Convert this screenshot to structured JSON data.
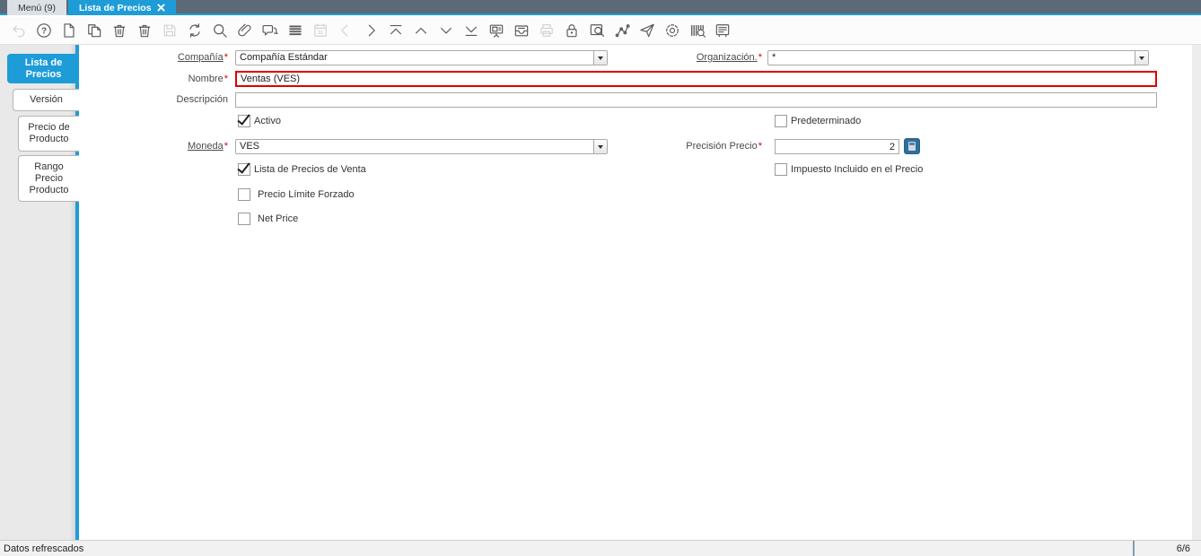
{
  "window_tabs": [
    {
      "label": "Menú (9)",
      "active": false
    },
    {
      "label": "Lista de Precios",
      "active": true
    }
  ],
  "toolbar": {
    "help_glyph": "?",
    "calendar_glyph": "31",
    "icons": [
      {
        "name": "undo",
        "disabled": true
      },
      {
        "name": "help",
        "disabled": false
      },
      {
        "name": "new-record",
        "disabled": false
      },
      {
        "name": "copy-record",
        "disabled": false
      },
      {
        "name": "delete-record",
        "disabled": false
      },
      {
        "name": "delete-selection",
        "disabled": false
      },
      {
        "name": "save",
        "disabled": true
      },
      {
        "name": "refresh",
        "disabled": false
      },
      {
        "name": "find",
        "disabled": false
      },
      {
        "name": "attachment",
        "disabled": false
      },
      {
        "name": "chat",
        "disabled": false
      },
      {
        "name": "grid-toggle",
        "disabled": false
      },
      {
        "name": "calendar",
        "disabled": true
      },
      {
        "name": "previous-record",
        "disabled": true
      },
      {
        "name": "next-record",
        "disabled": false
      },
      {
        "name": "first-record",
        "disabled": false
      },
      {
        "name": "parent-record",
        "disabled": false
      },
      {
        "name": "detail-record",
        "disabled": false
      },
      {
        "name": "last-record",
        "disabled": false
      },
      {
        "name": "report",
        "disabled": false
      },
      {
        "name": "archive",
        "disabled": false
      },
      {
        "name": "print",
        "disabled": true
      },
      {
        "name": "lock",
        "disabled": false
      },
      {
        "name": "zoom-across",
        "disabled": false
      },
      {
        "name": "workflow",
        "disabled": false
      },
      {
        "name": "send",
        "disabled": false
      },
      {
        "name": "settings",
        "disabled": false
      },
      {
        "name": "product-info",
        "disabled": false
      },
      {
        "name": "window",
        "disabled": false
      }
    ]
  },
  "sidebar": {
    "tabs": [
      {
        "label": "Lista de Precios",
        "active": true
      },
      {
        "label": "Versión",
        "active": false
      },
      {
        "label": "Precio de Producto",
        "active": false
      },
      {
        "label": "Rango Precio Producto",
        "active": false
      }
    ]
  },
  "form": {
    "required_marker": "*",
    "fields": {
      "compania": {
        "label": "Compañía",
        "value": "Compañía Estándar",
        "required": true
      },
      "organizacion": {
        "label": "Organización.",
        "value": "*",
        "required": true
      },
      "nombre": {
        "label": "Nombre",
        "value": "Ventas (VES)",
        "required": true
      },
      "descripcion": {
        "label": "Descripción",
        "value": ""
      },
      "activo": {
        "label": "Activo",
        "checked": true
      },
      "predeterminado": {
        "label": "Predeterminado",
        "checked": false
      },
      "moneda": {
        "label": "Moneda",
        "value": "VES",
        "required": true
      },
      "precision_precio": {
        "label": "Precisión Precio",
        "value": "2",
        "required": true
      },
      "lista_de_precios_de_venta": {
        "label": "Lista de Precios de Venta",
        "checked": true
      },
      "impuesto_incluido": {
        "label": "Impuesto Incluido en el Precio",
        "checked": false
      },
      "precio_limite_forzado": {
        "label": "Precio Límite Forzado",
        "checked": false
      },
      "net_price": {
        "label": "Net Price",
        "checked": false
      }
    }
  },
  "statusbar": {
    "message": "Datos refrescados",
    "record_indicator": "6/6"
  },
  "colors": {
    "accent_blue": "#1e9cd8",
    "topbar_slate": "#5b6a76",
    "highlight_red": "#e00000",
    "calculator_button_blue": "#2f6e9d"
  }
}
